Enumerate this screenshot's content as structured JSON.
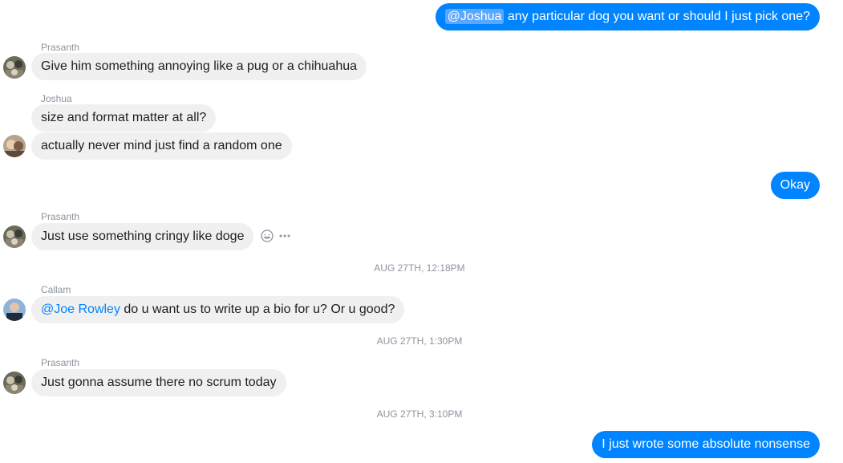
{
  "messages": {
    "m1": {
      "mention": "@Joshua",
      "text": " any particular dog you want or should I just pick one?"
    },
    "m2": {
      "sender": "Prasanth",
      "text": "Give him something annoying like a pug or a chihuahua"
    },
    "m3": {
      "sender": "Joshua",
      "text": "size and format matter at all?"
    },
    "m4": {
      "text": "actually never mind just find a random one"
    },
    "m5": {
      "text": "Okay"
    },
    "m6": {
      "sender": "Prasanth",
      "text": "Just use something cringy like doge"
    },
    "stamp1": "AUG 27TH, 12:18PM",
    "m7": {
      "sender": "Callam",
      "mention": "@Joe Rowley",
      "text": " do u want us to write up a bio for u? Or u good?"
    },
    "stamp2": "AUG 27TH, 1:30PM",
    "m8": {
      "sender": "Prasanth",
      "text": "Just gonna assume there no scrum today"
    },
    "stamp3": "AUG 27TH, 3:10PM",
    "m9": {
      "text": "I just wrote some absolute nonsense"
    }
  },
  "colors": {
    "outgoing": "#0084ff",
    "incoming": "#f1f0f0",
    "meta": "#8d949e"
  },
  "icons": [
    "smiley-reaction-icon",
    "more-options-icon"
  ]
}
